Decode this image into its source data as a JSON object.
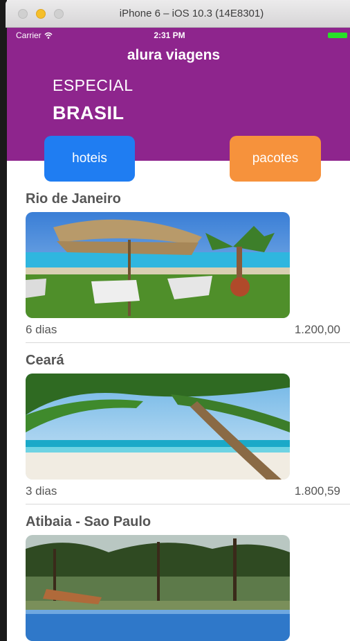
{
  "window": {
    "title": "iPhone 6 – iOS 10.3 (14E8301)"
  },
  "status_bar": {
    "carrier": "Carrier",
    "time": "2:31 PM",
    "wifi_icon": "wifi-icon",
    "battery_icon": "battery-icon"
  },
  "header": {
    "app_title": "alura viagens",
    "kicker": "ESPECIAL",
    "headline": "BRASIL",
    "background_color": "#8e258d"
  },
  "buttons": {
    "hotels": {
      "label": "hoteis",
      "color": "#1f7df2"
    },
    "packages": {
      "label": "pacotes",
      "color": "#f6923c"
    }
  },
  "packages": [
    {
      "title": "Rio de Janeiro",
      "days": "6 dias",
      "price": "1.200,00",
      "image": "pool-umbrella-photo"
    },
    {
      "title": "Ceará",
      "days": "3 dias",
      "price": "1.800,59",
      "image": "beach-palm-photo"
    },
    {
      "title": "Atibaia - Sao Paulo",
      "image": "forest-pool-photo"
    }
  ]
}
